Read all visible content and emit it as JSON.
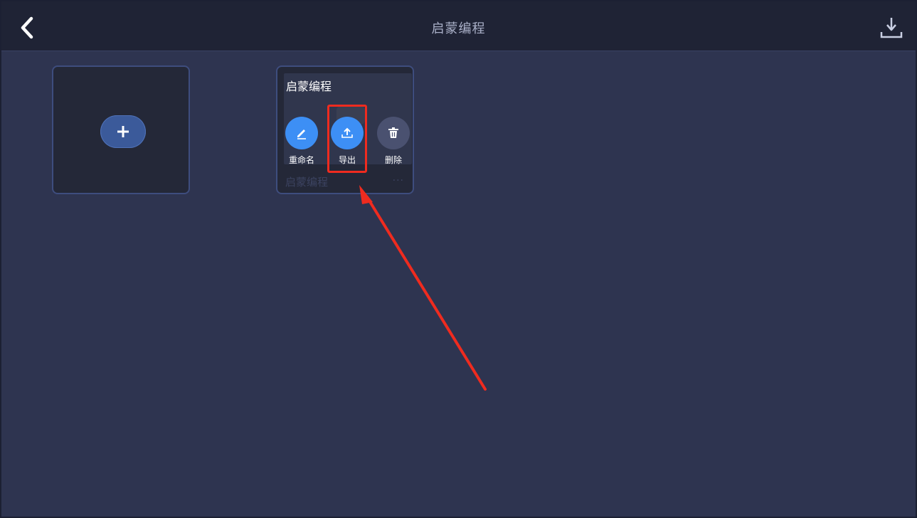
{
  "header": {
    "title": "启蒙编程",
    "back_icon": "chevron-left-icon",
    "download_icon": "download-icon"
  },
  "new_project": {
    "icon": "plus-icon"
  },
  "project": {
    "title": "启蒙编程",
    "footer_name": "启蒙编程",
    "more": "···",
    "actions": [
      {
        "label": "重命名",
        "icon": "pencil-icon",
        "color": "#3d8ff5"
      },
      {
        "label": "导出",
        "icon": "upload-icon",
        "color": "#3d8ff5"
      },
      {
        "label": "删除",
        "icon": "trash-icon",
        "color": "#4a5170"
      }
    ]
  },
  "colors": {
    "background": "#2e3450",
    "topbar": "#1f2335",
    "accent": "#3d8ff5",
    "annotation": "#ef2b1f"
  }
}
